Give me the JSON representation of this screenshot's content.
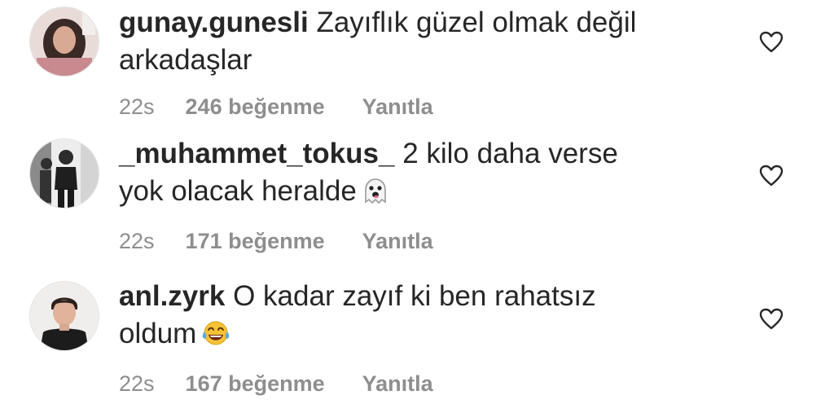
{
  "comments": [
    {
      "username": "gunay.gunesli",
      "line1": "Zayıflık güzel olmak değil",
      "line2": "arkadaşlar",
      "emoji": "",
      "time": "22s",
      "likes": "246 beğenme",
      "reply": "Yanıtla"
    },
    {
      "username": "_muhammet_tokus_",
      "line1": "2 kilo daha verse",
      "line2": "yok olacak heralde",
      "emoji": "ghost",
      "time": "22s",
      "likes": "171 beğenme",
      "reply": "Yanıtla"
    },
    {
      "username": "anl.zyrk",
      "line1": "O kadar zayıf ki ben rahatsız",
      "line2": "oldum",
      "emoji": "tears-of-joy",
      "time": "22s",
      "likes": "167 beğenme",
      "reply": "Yanıtla"
    }
  ],
  "colors": {
    "text": "#262626",
    "meta": "#8e8e8e",
    "heart": "#262626"
  }
}
